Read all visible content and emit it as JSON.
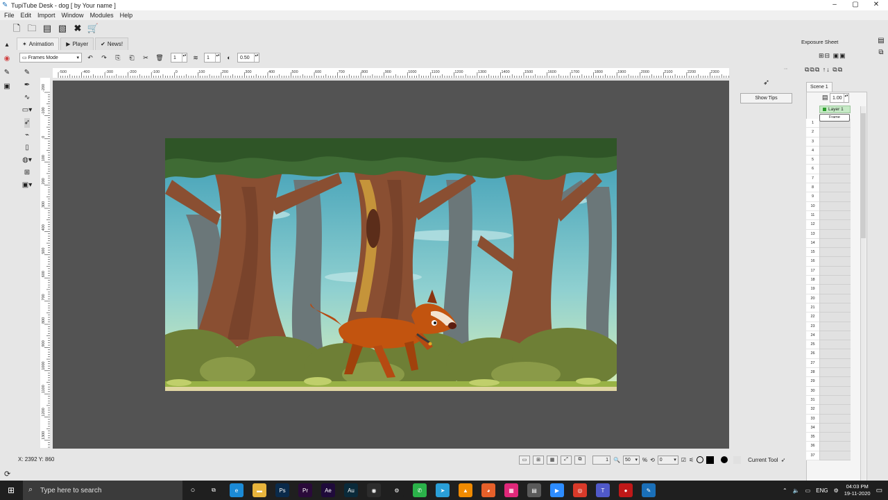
{
  "window": {
    "title": "TupiTube Desk - dog [ by Your name ]"
  },
  "menu": [
    "File",
    "Edit",
    "Import",
    "Window",
    "Modules",
    "Help"
  ],
  "tabs": [
    {
      "label": "Animation",
      "icon": "animation-icon"
    },
    {
      "label": "Player",
      "icon": "play-icon"
    },
    {
      "label": "News!",
      "icon": "news-icon"
    }
  ],
  "paint_toolbar": {
    "mode": "Frames Mode",
    "spin1": "1",
    "spin2": "1",
    "opacity": "0.50"
  },
  "ruler": {
    "h_ticks": [
      "-500",
      "-400",
      "-300",
      "-200",
      "-100",
      "0",
      "100",
      "200",
      "300",
      "400",
      "500",
      "600",
      "700",
      "800",
      "900",
      "1000",
      "1100",
      "1200",
      "1300",
      "1400",
      "1500",
      "1600",
      "1700",
      "1800",
      "1900",
      "2000",
      "2100",
      "2200",
      "2300"
    ],
    "v_ticks": [
      "-200",
      "-100",
      "0",
      "100",
      "200",
      "300",
      "400",
      "500",
      "600",
      "700",
      "800",
      "900",
      "1000",
      "1100",
      "1200",
      "1300"
    ]
  },
  "show_tips": "Show Tips",
  "status": {
    "coords": "X: 2392 Y: 860",
    "frame": "1",
    "zoom": "50",
    "zoom_unit": "%",
    "rotation": "0",
    "current_tool": "Current Tool"
  },
  "exposure": {
    "title": "Exposure Sheet",
    "scene": "Scene 1",
    "fps": "1.00",
    "layer": "Layer 1",
    "first_cell": "Frame",
    "rows": [
      "1",
      "2",
      "3",
      "4",
      "5",
      "6",
      "7",
      "8",
      "9",
      "10",
      "11",
      "12",
      "13",
      "14",
      "15",
      "16",
      "17",
      "18",
      "19",
      "20",
      "21",
      "22",
      "23",
      "24",
      "25",
      "26",
      "27",
      "28",
      "29",
      "30",
      "31",
      "32",
      "33",
      "34",
      "35",
      "36",
      "37"
    ]
  },
  "taskbar": {
    "search_placeholder": "Type here to search",
    "lang": "ENG",
    "time": "04:03 PM",
    "date": "19-11-2020",
    "apps": [
      {
        "name": "task-view-icon",
        "label": "⧉",
        "color": "#1f1f1f"
      },
      {
        "name": "edge-icon",
        "label": "e",
        "color": "#1b8ad6"
      },
      {
        "name": "file-explorer-icon",
        "label": "▬",
        "color": "#e8b43c"
      },
      {
        "name": "photoshop-icon",
        "label": "Ps",
        "color": "#0a2a4a"
      },
      {
        "name": "premiere-icon",
        "label": "Pr",
        "color": "#2a0a3a"
      },
      {
        "name": "after-effects-icon",
        "label": "Ae",
        "color": "#1f0a3a"
      },
      {
        "name": "audition-icon",
        "label": "Au",
        "color": "#0a2a3a"
      },
      {
        "name": "camera-icon",
        "label": "◉",
        "color": "#2c2c2c"
      },
      {
        "name": "settings-icon",
        "label": "⚙",
        "color": "#1f1f1f"
      },
      {
        "name": "whatsapp-icon",
        "label": "✆",
        "color": "#2bb34a"
      },
      {
        "name": "telegram-icon",
        "label": "➤",
        "color": "#2a9fd8"
      },
      {
        "name": "vlc-icon",
        "label": "▲",
        "color": "#f08a00"
      },
      {
        "name": "firefox-icon",
        "label": "◕",
        "color": "#e7602a"
      },
      {
        "name": "app-pink-icon",
        "label": "▦",
        "color": "#e0287a"
      },
      {
        "name": "calculator-icon",
        "label": "▤",
        "color": "#5a5a5a"
      },
      {
        "name": "zoom-icon",
        "label": "▶",
        "color": "#2d8cff"
      },
      {
        "name": "chrome-icon",
        "label": "◎",
        "color": "#d93a2a"
      },
      {
        "name": "teams-icon",
        "label": "T",
        "color": "#5059c9"
      },
      {
        "name": "recorder-icon",
        "label": "●",
        "color": "#c01818"
      },
      {
        "name": "tupitube-icon",
        "label": "✎",
        "color": "#1a6fb8"
      }
    ]
  }
}
